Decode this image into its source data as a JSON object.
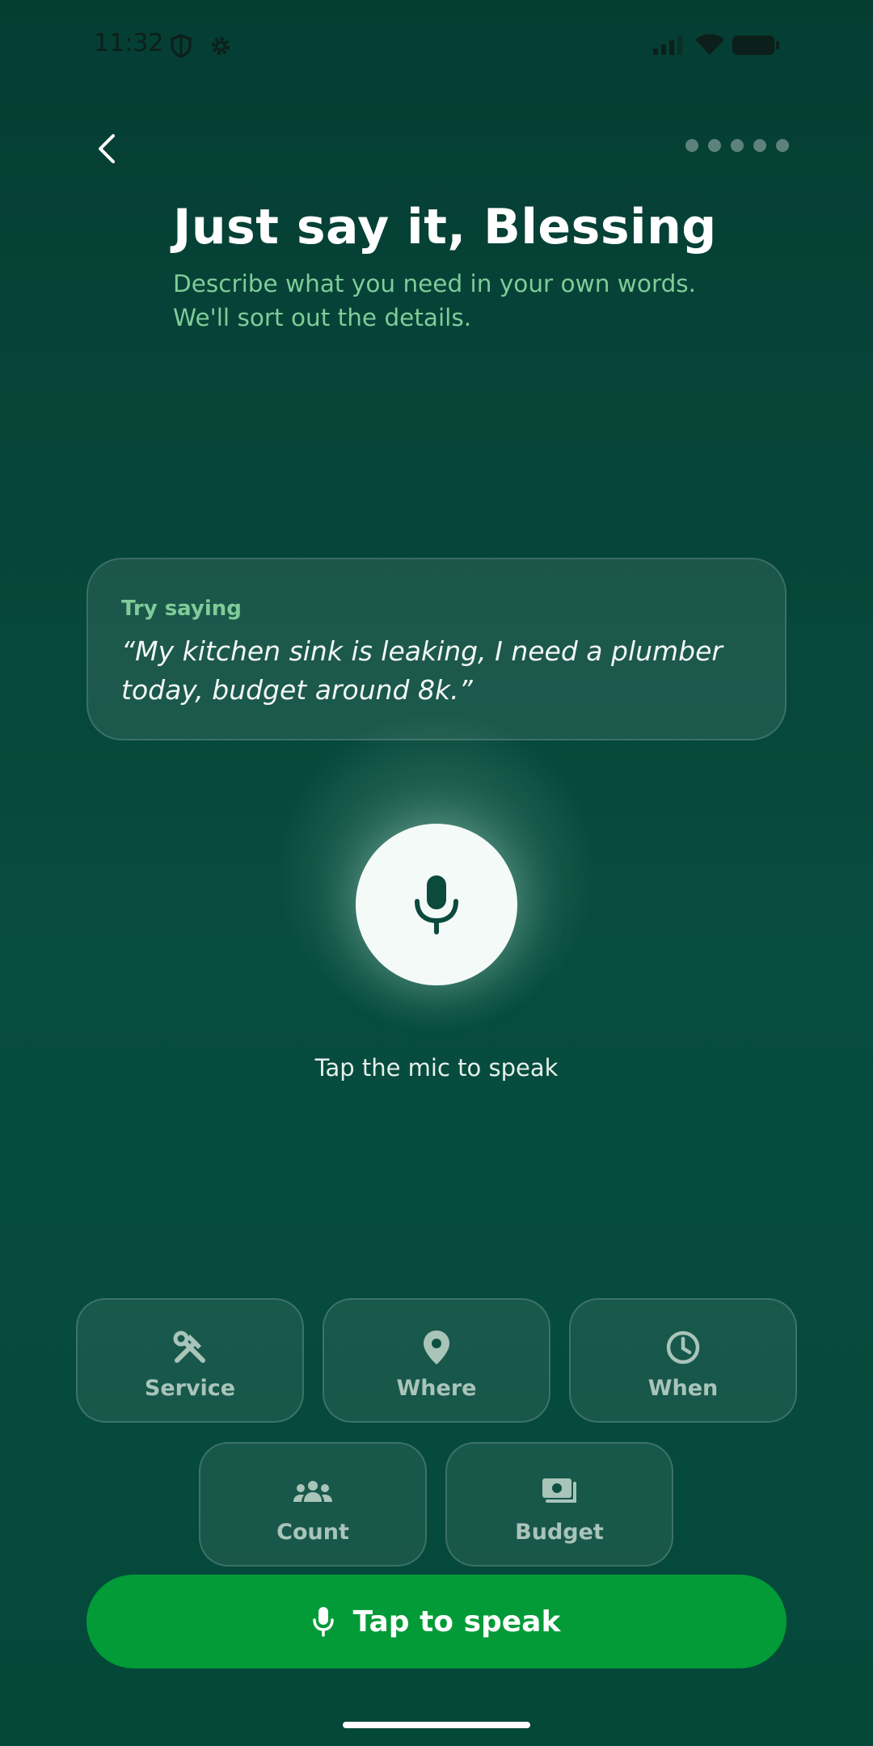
{
  "status_bar": {
    "time": "11:32"
  },
  "header": {
    "title": "Just say it, Blessing",
    "subtitle": "Describe what you need in your own words. We'll sort out the details.",
    "progress_steps": 5
  },
  "suggestion": {
    "label": "Try saying",
    "quote": "“My kitchen sink is leaking, I need a plumber today, budget around 8k.”"
  },
  "mic": {
    "hint": "Tap the mic to speak"
  },
  "chips": [
    {
      "label": "Service",
      "icon": "tools-icon"
    },
    {
      "label": "Where",
      "icon": "location-pin-icon"
    },
    {
      "label": "When",
      "icon": "clock-icon"
    },
    {
      "label": "Count",
      "icon": "people-icon"
    },
    {
      "label": "Budget",
      "icon": "money-icon"
    }
  ],
  "primary_button": {
    "label": "Tap to speak",
    "icon": "mic-icon"
  },
  "colors": {
    "background": "#053d33",
    "accent_green": "#029b37",
    "subtitle_green": "#7fcc98"
  }
}
